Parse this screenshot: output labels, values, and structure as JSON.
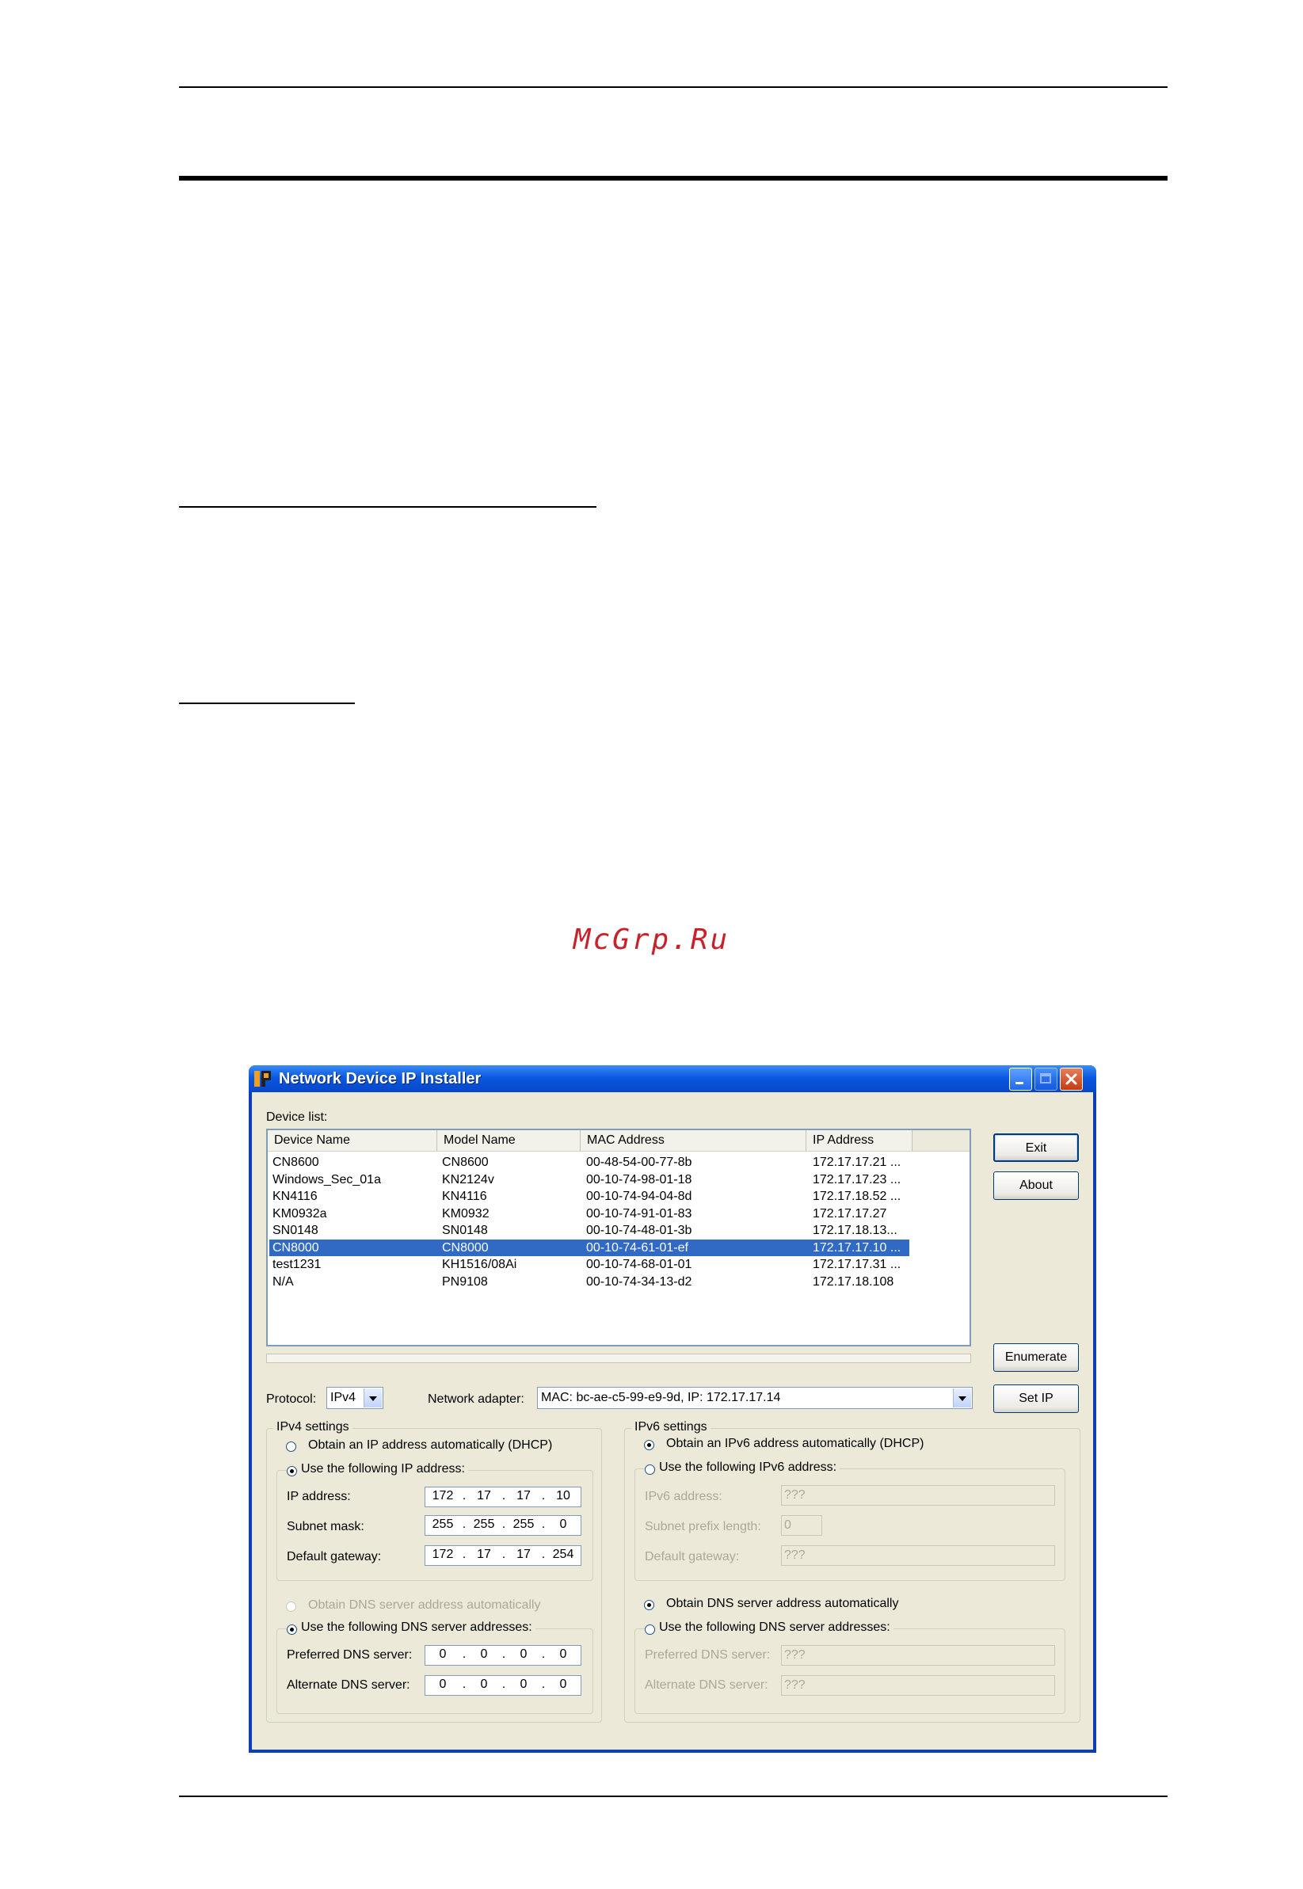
{
  "document": {
    "watermark": "McGrp.Ru"
  },
  "window": {
    "title": "Network Device IP Installer",
    "device_list_label": "Device list:",
    "columns": [
      "Device Name",
      "Model Name",
      "MAC Address",
      "IP Address"
    ],
    "devices": [
      [
        "CN8600",
        "CN8600",
        "00-48-54-00-77-8b",
        "172.17.17.21 ..."
      ],
      [
        "Windows_Sec_01a",
        "KN2124v",
        "00-10-74-98-01-18",
        "172.17.17.23 ..."
      ],
      [
        "KN4116",
        "KN4116",
        "00-10-74-94-04-8d",
        "172.17.18.52 ..."
      ],
      [
        "KM0932a",
        "KM0932",
        "00-10-74-91-01-83",
        "172.17.17.27"
      ],
      [
        "SN0148",
        "SN0148",
        "00-10-74-48-01-3b",
        "172.17.18.13..."
      ],
      [
        "CN8000",
        "CN8000",
        "00-10-74-61-01-ef",
        "172.17.17.10 ..."
      ],
      [
        "test1231",
        "KH1516/08Ai",
        "00-10-74-68-01-01",
        "172.17.17.31 ..."
      ],
      [
        "N/A",
        "PN9108",
        "00-10-74-34-13-d2",
        "172.17.18.108"
      ]
    ],
    "selected_device": "CN8000",
    "buttons": {
      "exit": "Exit",
      "about": "About",
      "enumerate": "Enumerate",
      "set_ip": "Set IP"
    },
    "protocol_label": "Protocol:",
    "protocol_value": "IPv4",
    "adapter_label": "Network adapter:",
    "adapter_value": "MAC: bc-ae-c5-99-e9-9d,   IP: 172.17.17.14",
    "ipv4": {
      "title": "IPv4 settings",
      "dhcp_label": "Obtain an IP address automatically (DHCP)",
      "static_label": "Use the following IP address:",
      "ip_label": "IP address:",
      "ip": [
        "172",
        "17",
        "17",
        "10"
      ],
      "mask_label": "Subnet mask:",
      "mask": [
        "255",
        "255",
        "255",
        "0"
      ],
      "gateway_label": "Default gateway:",
      "gateway": [
        "172",
        "17",
        "17",
        "254"
      ],
      "dns_auto_label": "Obtain DNS server address automatically",
      "dns_static_label": "Use the following DNS server addresses:",
      "pref_dns_label": "Preferred DNS server:",
      "pref_dns": [
        "0",
        "0",
        "0",
        "0"
      ],
      "alt_dns_label": "Alternate DNS server:",
      "alt_dns": [
        "0",
        "0",
        "0",
        "0"
      ]
    },
    "ipv6": {
      "title": "IPv6 settings",
      "dhcp_label": "Obtain an IPv6 address automatically (DHCP)",
      "static_label": "Use the following IPv6 address:",
      "addr_label": "IPv6 address:",
      "addr_value": "???",
      "prefix_label": "Subnet prefix length:",
      "prefix_value": "0",
      "gateway_label": "Default gateway:",
      "gateway_value": "???",
      "dns_auto_label": "Obtain DNS server address automatically",
      "dns_static_label": "Use the following DNS server addresses:",
      "pref_dns_label": "Preferred DNS server:",
      "pref_dns_value": "???",
      "alt_dns_label": "Alternate DNS server:",
      "alt_dns_value": "???"
    }
  }
}
